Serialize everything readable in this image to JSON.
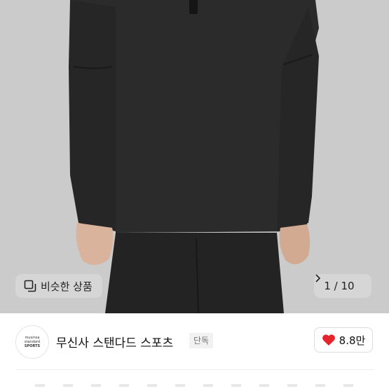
{
  "product_image": {
    "icon": "product-photo"
  },
  "similar": {
    "label": "비슷한 상품",
    "icon": "similar-icon"
  },
  "pager": {
    "text": "1 / 10",
    "icon": "chevron-right-icon"
  },
  "brand": {
    "logo_lines": [
      "musinsa",
      "standard",
      "SPORTS"
    ],
    "name": "무신사 스탠다드 스포츠",
    "badge": "단독"
  },
  "like": {
    "count": "8.8만",
    "icon": "heart-icon",
    "color": "#e5242b"
  }
}
